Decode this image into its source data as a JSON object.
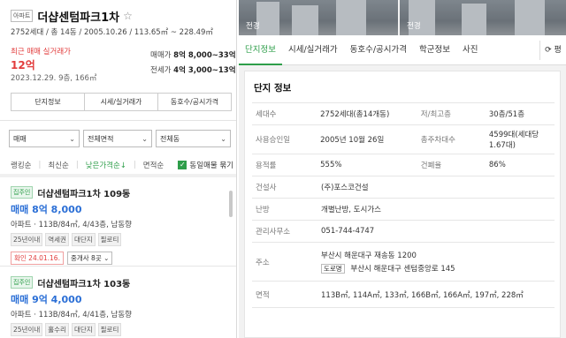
{
  "listing": {
    "badge": "아파트",
    "title": "더샵센텀파크1차",
    "meta": "2752세대 / 총 14동 / 2005.10.26 / 113.65㎡ ~ 228.49㎡",
    "recent_label": "최근 매매 실거래가",
    "recent_price": "12억",
    "recent_date": "2023.12.29. 9층, 166㎡",
    "sale_label": "매매가",
    "sale_range": "8억 8,000~33억",
    "rent_label": "전세가",
    "rent_range": "4억 3,000~13억",
    "buttons": [
      "단지정보",
      "시세/실거래가",
      "동호수/공시가격"
    ]
  },
  "filters": {
    "trade": "매매",
    "area": "전체면적",
    "building": "전체동"
  },
  "sort": {
    "items": [
      "랭킹순",
      "최신순",
      "낮은가격순↓",
      "면적순"
    ],
    "checkbox": "동일매물 묶기"
  },
  "cards": [
    {
      "tag": "집주인",
      "name": "더샵센텀파크1차 109동",
      "price": "매매 8억 8,000",
      "spec": "아파트 · 113B/84㎡, 4/43층, 남동향",
      "tags": [
        "25년이내",
        "역세권",
        "대단지",
        "필로티"
      ],
      "confirm": "확인 24.01.16.",
      "agent": "중개사 8곳"
    },
    {
      "tag": "집주인",
      "name": "더샵센텀파크1차 103동",
      "price": "매매 9억 4,000",
      "spec": "아파트 · 113B/84㎡, 4/41층, 남동향",
      "tags": [
        "25년이내",
        "홀수리",
        "대단지",
        "필로티"
      ]
    }
  ],
  "photos": [
    "전경",
    "전경"
  ],
  "tabs": [
    "단지정보",
    "시세/실거래가",
    "동호수/공시가격",
    "학군정보",
    "사진"
  ],
  "tab_more": "⟳ 평",
  "info": {
    "title": "단지 정보",
    "households_label": "세대수",
    "households": "2752세대(총14개동)",
    "floors_label": "저/최고층",
    "floors": "30층/51층",
    "approval_label": "사용승인일",
    "approval": "2005년 10월 26일",
    "parking_label": "총주차대수",
    "parking": "4599대(세대당 1.67대)",
    "far_label": "용적률",
    "far": "555%",
    "bcr_label": "건폐율",
    "bcr": "86%",
    "builder_label": "건설사",
    "builder": "(주)포스코건설",
    "heating_label": "난방",
    "heating": "개별난방, 도시가스",
    "office_label": "관리사무소",
    "office": "051-744-4747",
    "address_label": "주소",
    "address": "부산시 해운대구 재송동 1200",
    "road_tag": "도로명",
    "road_address": "부산시 해운대구 센텀중앙로 145",
    "area_label": "면적",
    "areas": "113B㎡, 114A㎡, 133㎡, 166B㎡, 166A㎡, 197㎡, 228㎡"
  }
}
